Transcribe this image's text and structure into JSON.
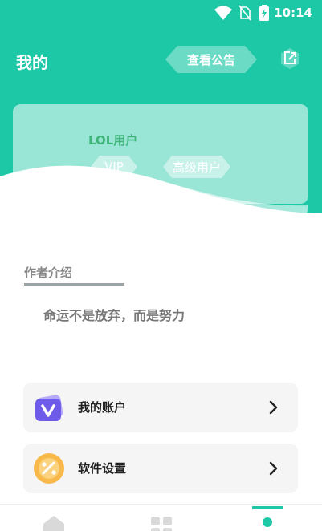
{
  "status_bar": {
    "time": "10:14"
  },
  "header": {
    "title": "我的",
    "notice_button": "查看公告"
  },
  "profile": {
    "username": "LOL用户",
    "tags": [
      "VIP",
      "高级用户"
    ]
  },
  "intro": {
    "title": "作者介绍",
    "text": "命运不是放弃，而是努力"
  },
  "menu": [
    {
      "label": "我的账户",
      "icon": "vip-v-icon"
    },
    {
      "label": "软件设置",
      "icon": "percent-icon"
    }
  ],
  "tabs": [
    {
      "name": "home",
      "icon": "home-icon"
    },
    {
      "name": "apps",
      "icon": "grid-icon"
    },
    {
      "name": "mine",
      "icon": "dot-icon",
      "active": true
    }
  ],
  "colors": {
    "accent": "#1dc8a7",
    "username": "#3fb57a",
    "card_bg": "#f5f5f5"
  }
}
